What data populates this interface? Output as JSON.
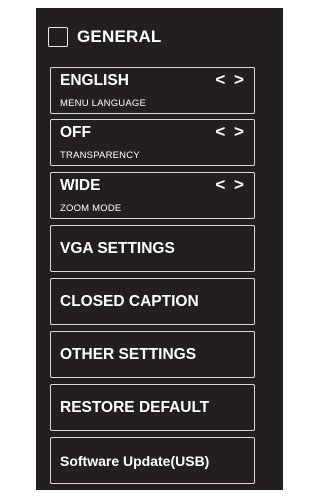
{
  "header": {
    "title": "GENERAL"
  },
  "options": [
    {
      "value": "ENGLISH",
      "label": "MENU LANGUAGE",
      "arrows": "< >"
    },
    {
      "value": "OFF",
      "label": "TRANSPARENCY",
      "arrows": "< >"
    },
    {
      "value": "WIDE",
      "label": "ZOOM MODE",
      "arrows": "< >"
    }
  ],
  "buttons": [
    "VGA SETTINGS",
    "CLOSED CAPTION",
    "OTHER SETTINGS",
    "RESTORE DEFAULT",
    "Software Update(USB)"
  ]
}
